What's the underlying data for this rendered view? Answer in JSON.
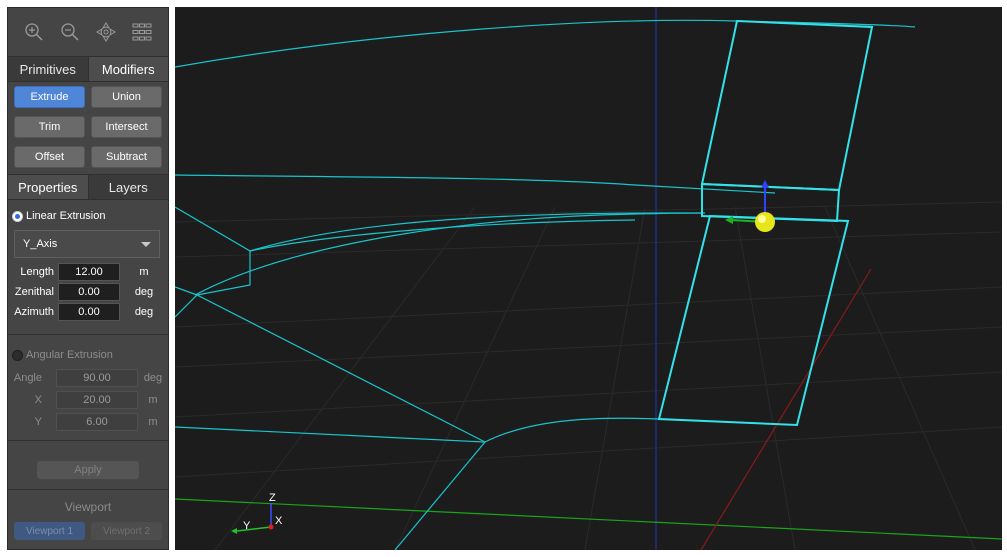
{
  "toolbar": {
    "icons": [
      "zoom-in-icon",
      "zoom-out-icon",
      "fit-view-icon",
      "grid-view-icon"
    ]
  },
  "top_tabs": [
    "Primitives",
    "Modifiers"
  ],
  "modifiers": {
    "buttons": [
      "Extrude",
      "Union",
      "Trim",
      "Intersect",
      "Offset",
      "Subtract"
    ],
    "selected": "Extrude"
  },
  "lower_tabs": [
    "Properties",
    "Layers"
  ],
  "linear": {
    "label": "Linear Extrusion",
    "axis": "Y_Axis",
    "fields": [
      {
        "label": "Length",
        "value": "12.00",
        "unit": "m"
      },
      {
        "label": "Zenithal",
        "value": "0.00",
        "unit": "deg"
      },
      {
        "label": "Azimuth",
        "value": "0.00",
        "unit": "deg"
      }
    ]
  },
  "angular": {
    "label": "Angular Extrusion",
    "fields": [
      {
        "label": "Angle",
        "value": "90.00",
        "unit": "deg"
      },
      {
        "label": "X",
        "value": "20.00",
        "unit": "m"
      },
      {
        "label": "Y",
        "value": "6.00",
        "unit": "m"
      }
    ]
  },
  "apply_label": "Apply",
  "viewport_section": {
    "title": "Viewport",
    "buttons": [
      "Viewport 1",
      "Viewport 2"
    ]
  },
  "axes": {
    "z": "Z",
    "y": "Y",
    "x": "X"
  },
  "colors": {
    "wireframe": "#19c4cc",
    "highlight": "#33e2e8",
    "accent": "#4f86d8",
    "viewport_bg": "#1c1c1c"
  }
}
